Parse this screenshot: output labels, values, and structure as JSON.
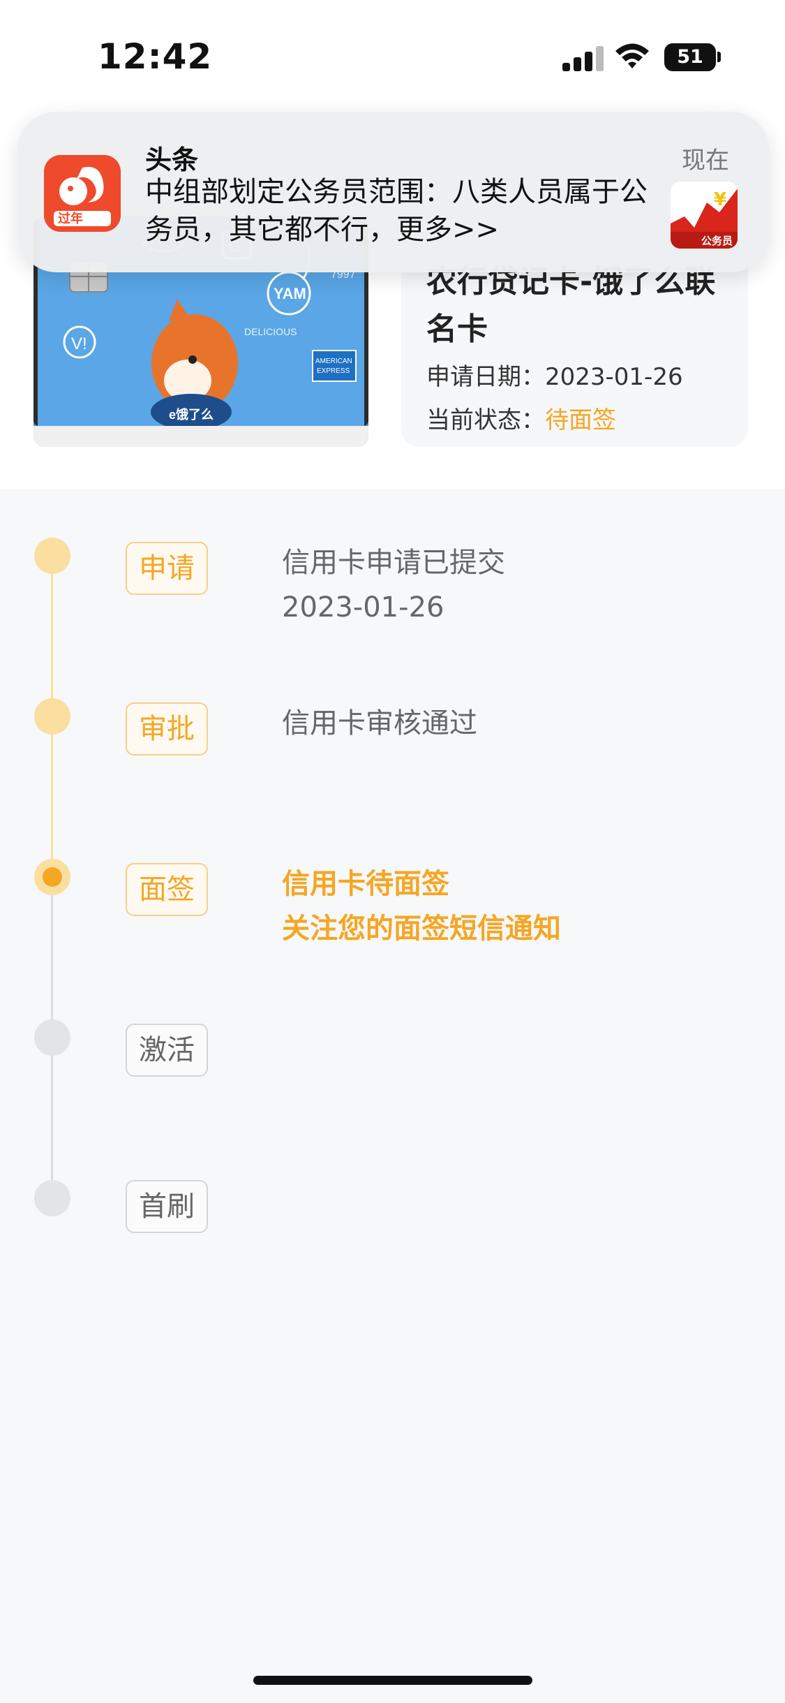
{
  "status_bar": {
    "time": "12:42",
    "battery": "51"
  },
  "notification": {
    "app": "头条",
    "time": "现在",
    "body": "中组部划定公务员范围：八类人员属于公务员，其它都不行，更多>>",
    "thumb_label": "公务员"
  },
  "card": {
    "name": "农行贷记卡-饿了么联名卡",
    "apply_date_label": "申请日期：",
    "apply_date": "2023-01-26",
    "status_label": "当前状态：",
    "status": "待面签",
    "status_color": "#f5a623"
  },
  "timeline": {
    "steps": [
      {
        "tag": "申请",
        "line1": "信用卡申请已提交",
        "line2": "2023-01-26",
        "state": "done"
      },
      {
        "tag": "审批",
        "line1": "信用卡审核通过",
        "line2": "",
        "state": "done"
      },
      {
        "tag": "面签",
        "line1": "信用卡待面签",
        "line2": "关注您的面签短信通知",
        "state": "current"
      },
      {
        "tag": "激活",
        "line1": "",
        "line2": "",
        "state": "pending"
      },
      {
        "tag": "首刷",
        "line1": "",
        "line2": "",
        "state": "pending"
      }
    ]
  },
  "colors": {
    "accent": "#f5a623",
    "accent_light": "#fbdfa1",
    "pending": "#e3e4e6"
  }
}
